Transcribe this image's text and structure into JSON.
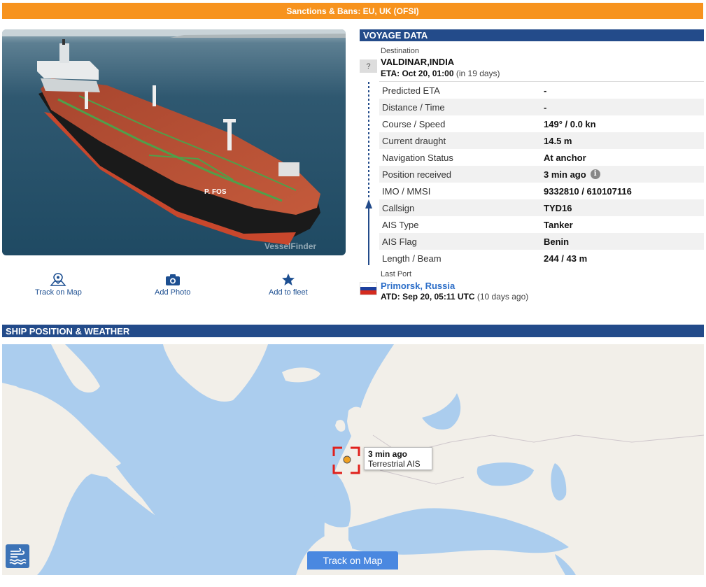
{
  "sanctions": {
    "text": "Sanctions & Bans: EU, UK (OFSI)"
  },
  "photo": {
    "watermark": "VesselFinder",
    "hull_name": "P. FOS"
  },
  "actions": {
    "track_on_map": "Track on Map",
    "add_photo": "Add Photo",
    "add_to_fleet": "Add to fleet"
  },
  "voyage": {
    "header": "VOYAGE DATA",
    "destination_label": "Destination",
    "destination_value": "VALDINAR,INDIA",
    "eta_label": "ETA:",
    "eta_value": "Oct 20, 01:00",
    "eta_relative": "(in 19 days)",
    "unknown_flag": "?",
    "rows": [
      {
        "k": "Predicted ETA",
        "v": "-"
      },
      {
        "k": "Distance / Time",
        "v": "-"
      },
      {
        "k": "Course / Speed",
        "v": "149° / 0.0 kn"
      },
      {
        "k": "Current draught",
        "v": "14.5 m"
      },
      {
        "k": "Navigation Status",
        "v": "At anchor"
      },
      {
        "k": "Position received",
        "v": "3 min ago"
      },
      {
        "k": "IMO / MMSI",
        "v": "9332810 / 610107116"
      },
      {
        "k": "Callsign",
        "v": "TYD16"
      },
      {
        "k": "AIS Type",
        "v": "Tanker"
      },
      {
        "k": "AIS Flag",
        "v": "Benin"
      },
      {
        "k": "Length / Beam",
        "v": "244 / 43 m"
      }
    ],
    "info_glyph": "i",
    "last_port_label": "Last Port",
    "last_port_value": "Primorsk, Russia",
    "atd_label": "ATD:",
    "atd_value": "Sep 20, 05:11 UTC",
    "atd_relative": "(10 days ago)"
  },
  "position": {
    "header": "SHIP POSITION & WEATHER",
    "popup_time": "3 min ago",
    "popup_source": "Terrestrial AIS",
    "track_button": "Track on Map"
  },
  "colors": {
    "accent_orange": "#f7931e",
    "header_blue": "#234b8a",
    "link_blue": "#2c6ec8",
    "sea": "#abcdee",
    "land": "#f2efe9"
  },
  "icons": {
    "track": "map-pin-icon",
    "photo": "camera-icon",
    "fleet": "star-icon",
    "weather": "wind-wave-icon",
    "flag": "russia-flag-icon"
  }
}
